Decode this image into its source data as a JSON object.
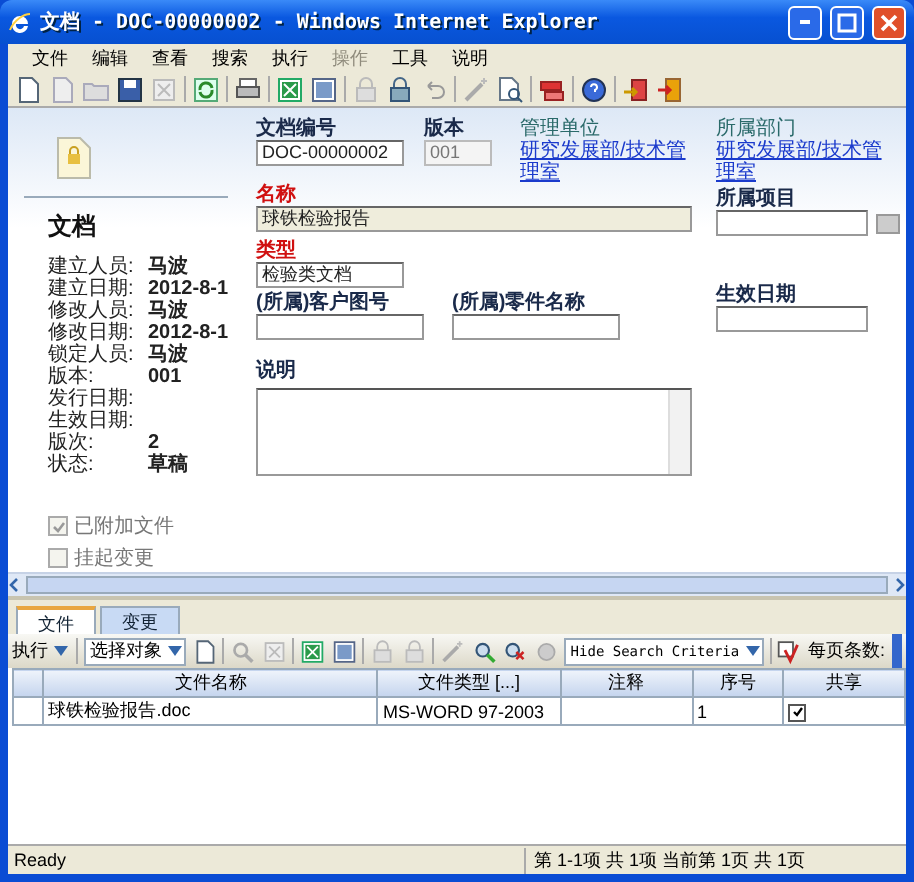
{
  "window": {
    "title": "文档 - DOC-00000002 - Windows Internet Explorer"
  },
  "menu": [
    {
      "label": "文件",
      "disabled": false
    },
    {
      "label": "编辑",
      "disabled": false
    },
    {
      "label": "查看",
      "disabled": false
    },
    {
      "label": "搜索",
      "disabled": false
    },
    {
      "label": "执行",
      "disabled": false
    },
    {
      "label": "操作",
      "disabled": true
    },
    {
      "label": "工具",
      "disabled": false
    },
    {
      "label": "说明",
      "disabled": false
    }
  ],
  "document_panel": {
    "heading": "文档",
    "properties": [
      {
        "label": "建立人员:",
        "value": "马波"
      },
      {
        "label": "建立日期:",
        "value": "2012-8-1"
      },
      {
        "label": "修改人员:",
        "value": "马波"
      },
      {
        "label": "修改日期:",
        "value": "2012-8-1"
      },
      {
        "label": "锁定人员:",
        "value": "马波"
      },
      {
        "label": "版本:",
        "value": "001"
      },
      {
        "label": "发行日期:"
      },
      {
        "label": "生效日期:"
      },
      {
        "label": "版次:",
        "value": "2"
      },
      {
        "label": "状态:",
        "value": "草稿"
      }
    ],
    "options": [
      {
        "label": "已附加文件",
        "checked": true
      },
      {
        "label": "挂起变更",
        "checked": false
      }
    ]
  },
  "form": {
    "doc_number": {
      "label": "文档编号",
      "value": "DOC-00000002"
    },
    "version": {
      "label": "版本",
      "value": "001",
      "disabled": true
    },
    "managing_unit": {
      "label": "管理单位",
      "link": "研究发展部/技术管理室"
    },
    "department": {
      "label": "所属部门",
      "link": "研究发展部/技术管理室"
    },
    "name": {
      "label": "名称",
      "value": "球铁检验报告",
      "required": true
    },
    "project": {
      "label": "所属项目"
    },
    "type": {
      "label": "类型",
      "value": "检验类文档",
      "required": true
    },
    "customer_drawing": {
      "label": "(所属)客户图号"
    },
    "part_name": {
      "label": "(所属)零件名称"
    },
    "effective_date": {
      "label": "生效日期"
    },
    "description": {
      "label": "说明"
    }
  },
  "tabs": [
    {
      "label": "文件",
      "selected": true
    },
    {
      "label": "变更",
      "selected": false
    }
  ],
  "grid_toolbar": {
    "execute": "执行",
    "object_select": "选择对象",
    "search_toggle": "Hide Search Criteria",
    "page_size_label": "每页条数:"
  },
  "table": {
    "columns": [
      "文件名称",
      "文件类型 [...]",
      "注释",
      "序号",
      "共享"
    ],
    "rows": [
      {
        "file_name": "球铁检验报告.doc",
        "file_type": "MS-WORD 97-2003",
        "sequence": "1",
        "shared": true
      }
    ]
  },
  "status_bar": {
    "status": "Ready",
    "paging": "第 1-1项 共 1项 当前第 1页 共 1页"
  }
}
